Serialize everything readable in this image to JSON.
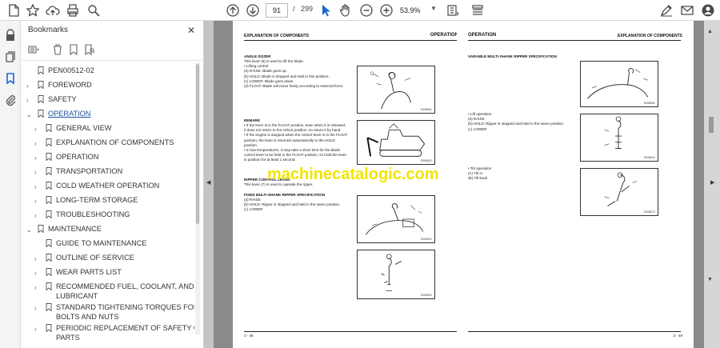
{
  "toolbar": {
    "page_current": "91",
    "page_separator": "/",
    "page_total": "299",
    "zoom": "53.9%"
  },
  "bookmarks": {
    "title": "Bookmarks",
    "close": "✕",
    "items": [
      {
        "label": "PEN00512-02",
        "arrow": ""
      },
      {
        "label": "FOREWORD",
        "arrow": "›"
      },
      {
        "label": "SAFETY",
        "arrow": "›"
      },
      {
        "label": "OPERATION",
        "arrow": "⌄"
      },
      {
        "label": "GENERAL VIEW",
        "arrow": "›"
      },
      {
        "label": "EXPLANATION OF COMPONENTS",
        "arrow": "›"
      },
      {
        "label": "OPERATION",
        "arrow": "›"
      },
      {
        "label": "TRANSPORTATION",
        "arrow": "›"
      },
      {
        "label": "COLD WEATHER OPERATION",
        "arrow": "›"
      },
      {
        "label": "LONG-TERM STORAGE",
        "arrow": "›"
      },
      {
        "label": "TROUBLESHOOTING",
        "arrow": "›"
      },
      {
        "label": "MAINTENANCE",
        "arrow": "⌄"
      },
      {
        "label": "GUIDE TO MAINTENANCE",
        "arrow": ""
      },
      {
        "label": "OUTLINE OF SERVICE",
        "arrow": "›"
      },
      {
        "label": "WEAR PARTS LIST",
        "arrow": "›"
      },
      {
        "label": "RECOMMENDED FUEL, COOLANT, AND",
        "label2": "LUBRICANT",
        "arrow": "›"
      },
      {
        "label": "STANDARD TIGHTENING TORQUES FOR",
        "label2": "BOLTS AND NUTS",
        "arrow": "›"
      },
      {
        "label": "PERIODIC REPLACEMENT OF SAFETY CRITICAL",
        "label2": "PARTS",
        "arrow": "›"
      }
    ]
  },
  "left_page": {
    "header_left": "EXPLANATION OF COMPONENTS",
    "header_right": "OPERATION",
    "angledozer_title": "ANGLE DOZER",
    "angledozer_lines": [
      "This lever (6) is used to lift the blade.",
      "• Lifting control",
      "(a) RAISE: Blade goes up.",
      "(b) HOLD: Blade is stopped and held in this position.",
      "(c) LOWER: Blade goes down.",
      "(d) FLOAT: Blade will move freely according to external force."
    ],
    "remark_title": "REMARK",
    "remark_lines": [
      "• If the lever is in the FLOAT position, even when it is released,",
      "  it does not return to the HOLD position, so return it by hand.",
      "• If the engine is stopped when the control lever is in the FLOAT",
      "  position, the lever is returned automatically to the HOLD",
      "  position.",
      "• In low temperatures, it may take a short time for the blade",
      "  control lever to be held in the FLOAT position, so hold the lever",
      "  in position for at least 1 second."
    ],
    "ripper_title": "RIPPER CONTROL LEVER",
    "ripper_lines": [
      "This lever (7) is used to operate the ripper."
    ],
    "fixed_title": "FIXED MULTI-SHANK RIPPER SPECIFICATION",
    "fixed_lines": [
      "(a) RAISE",
      "(b) HOLD: Ripper is stopped and held in the same position.",
      "(c) LOWER"
    ],
    "fig_ids": [
      "RJ08051",
      "RJ08031",
      "RJ08021",
      "RJ08031"
    ],
    "footer": "3 - 46"
  },
  "right_page": {
    "header_left": "OPERATION",
    "header_right": "EXPLANATION OF COMPONENTS",
    "variable_title": "VARIABLE MULTI-SHANK RIPPER SPECIFICATION",
    "lift_lines": [
      "• Lift operation",
      "(a) RAISE",
      "(b) HOLD: Ripper is stopped and held in the same position.",
      "(c) LOWER"
    ],
    "tilt_lines": [
      "• Tilt operation",
      "(A) Tilt in",
      "(B) Tilt back"
    ],
    "fig_ids": [
      "RJ08051",
      "RJ08041",
      "RJ08071"
    ],
    "footer": "3 - 49"
  },
  "watermark": "machinecatalogic.com"
}
